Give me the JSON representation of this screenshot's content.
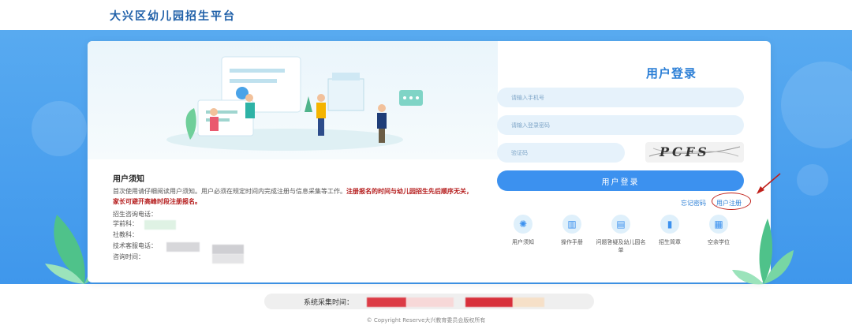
{
  "header": {
    "site_title": "大兴区幼儿园招生平台"
  },
  "notice": {
    "title": "用户须知",
    "text_normal": "首次使用请仔细阅读用户须知。用户必须在规定时间内完成注册与信息采集等工作。",
    "text_highlight": "注册报名的时间与幼儿园招生先后顺序无关，家长可避开高峰时段注册报名。",
    "contact_heading": "招生咨询电话：",
    "contact_lines": [
      "学前科：",
      "社教科：",
      "技术客服电话：",
      "咨询时间："
    ]
  },
  "login": {
    "title": "用户登录",
    "phone_placeholder": "请输入手机号",
    "password_placeholder": "请输入登录密码",
    "captcha_placeholder": "验证码",
    "captcha_text": "PCFS",
    "login_button": "用户登录",
    "forgot_link": "忘记密码",
    "register_link": "用户注册"
  },
  "quick_links": [
    {
      "label": "用户须知",
      "icon": "lightbulb-icon"
    },
    {
      "label": "操作手册",
      "icon": "book-icon"
    },
    {
      "label": "问题答疑及幼儿园名单",
      "icon": "document-icon"
    },
    {
      "label": "招生简章",
      "icon": "bookmark-icon"
    },
    {
      "label": "空余学位",
      "icon": "grid-icon"
    }
  ],
  "footer": {
    "collect_time_label": "系统采集时间：",
    "copyright": "© Copyright Reserve大兴教育委员会版权所有"
  },
  "colors": {
    "primary": "#3c91ef",
    "band": "#4a9fee",
    "highlight": "#b41a1a",
    "annotation": "#c0201a"
  }
}
